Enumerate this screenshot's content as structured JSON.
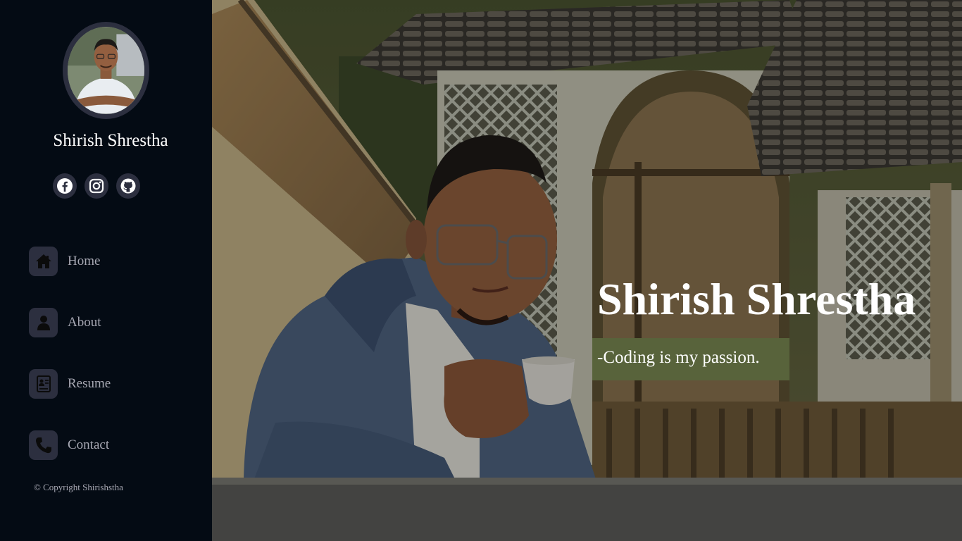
{
  "sidebar": {
    "profile_name": "Shirish Shrestha",
    "socials": [
      {
        "icon": "facebook-icon"
      },
      {
        "icon": "instagram-icon"
      },
      {
        "icon": "github-icon"
      }
    ],
    "nav": [
      {
        "label": "Home",
        "icon": "home-icon"
      },
      {
        "label": "About",
        "icon": "user-icon"
      },
      {
        "label": "Resume",
        "icon": "resume-icon"
      },
      {
        "label": "Contact",
        "icon": "phone-icon"
      }
    ],
    "copyright": "© Copyright Shirishstha"
  },
  "hero": {
    "title": "Shirish Shrestha",
    "tagline": "-Coding is my passion."
  },
  "colors": {
    "sidebar_bg": "#040b14",
    "icon_bg": "#2c2f3f",
    "nav_text": "#a8a9b4",
    "text": "#ffffff"
  }
}
